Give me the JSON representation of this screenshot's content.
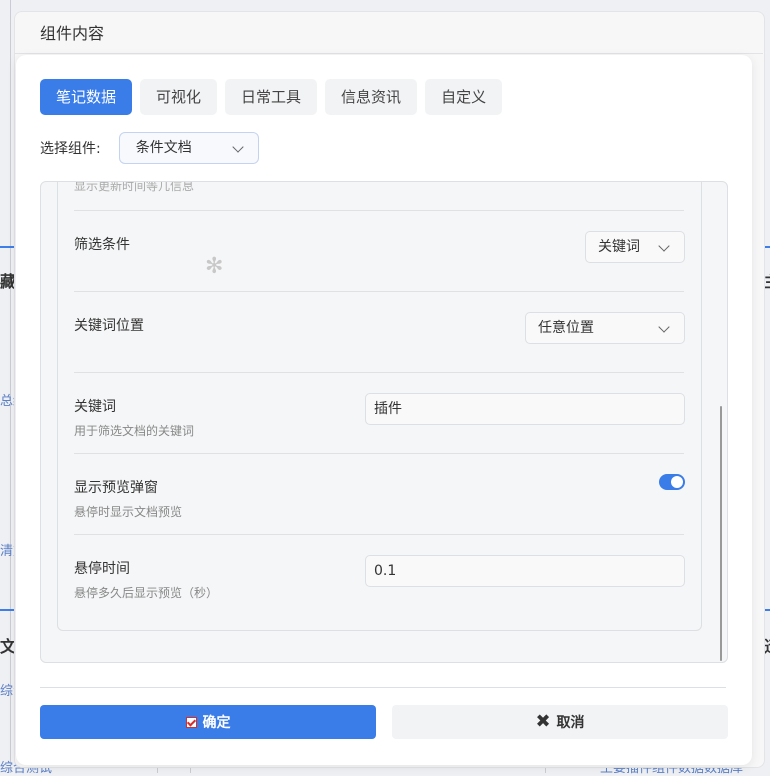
{
  "window": {
    "title": "组件内容"
  },
  "tabs": [
    {
      "label": "笔记数据",
      "active": true
    },
    {
      "label": "可视化",
      "active": false
    },
    {
      "label": "日常工具",
      "active": false
    },
    {
      "label": "信息资讯",
      "active": false
    },
    {
      "label": "自定义",
      "active": false
    }
  ],
  "selector": {
    "label": "选择组件:",
    "value": "条件文档"
  },
  "settings": {
    "partial_desc": "显示更新时间等几信息",
    "filter": {
      "title": "筛选条件",
      "value": "关键词"
    },
    "keyword_position": {
      "title": "关键词位置",
      "value": "任意位置"
    },
    "keyword": {
      "title": "关键词",
      "desc": "用于筛选文档的关键词",
      "value": "插件"
    },
    "preview_popup": {
      "title": "显示预览弹窗",
      "desc": "悬停时显示文档预览",
      "enabled": true
    },
    "hover_time": {
      "title": "悬停时间",
      "desc": "悬停多久后显示预览（秒）",
      "value": "0.1"
    }
  },
  "footer": {
    "confirm_label": "确定",
    "cancel_label": "取消"
  },
  "background": {
    "frag_1": "藏",
    "frag_2": "总结",
    "frag_3": "清重",
    "frag_4": "文",
    "frag_5": "综合测",
    "frag_6": "综合测试",
    "frag_7": "王要插件组件数据数据库"
  },
  "colors": {
    "accent": "#3a7ce8",
    "toggle_on": "#3a7ce8",
    "confirm_icon": "#d32f2f"
  }
}
